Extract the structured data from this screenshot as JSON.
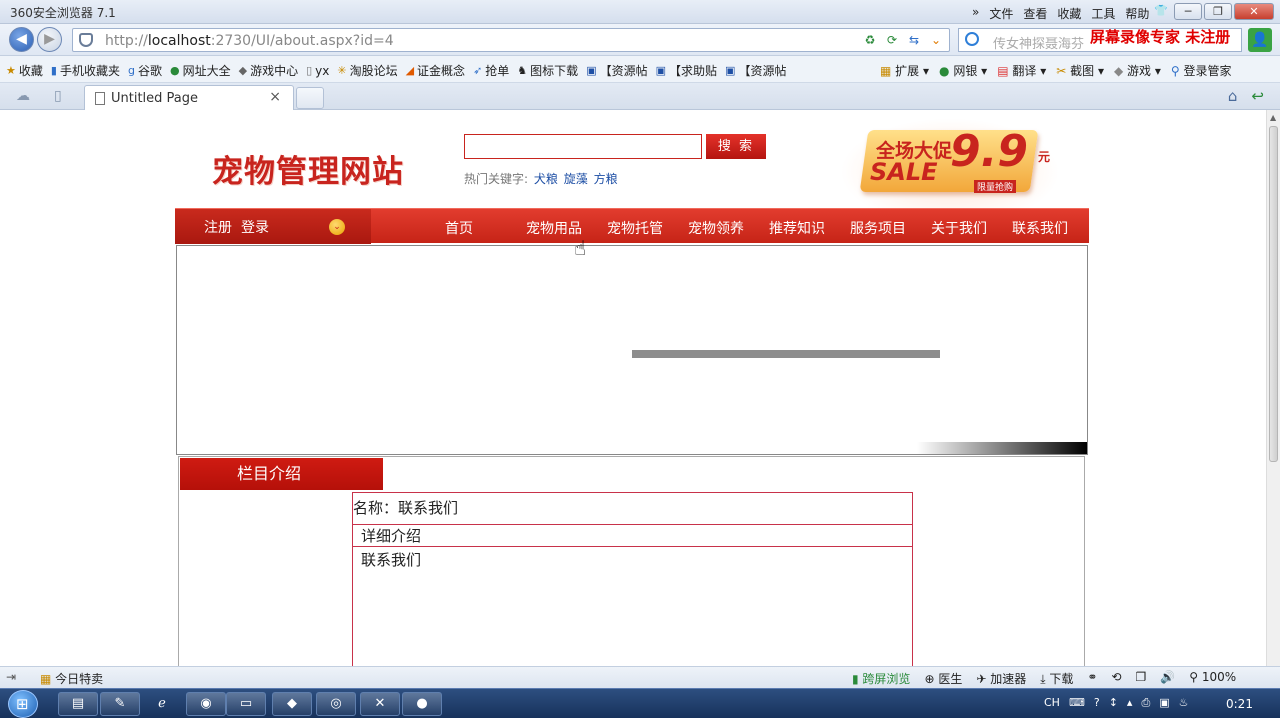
{
  "window": {
    "title": "360安全浏览器 7.1",
    "menus": [
      "»",
      "文件",
      "查看",
      "收藏",
      "工具",
      "帮助"
    ],
    "controls": {
      "shirt": "👕",
      "min": "─",
      "max": "❐",
      "close": "✕"
    }
  },
  "addressbar": {
    "back": "◀",
    "forward": "▶",
    "url_prefix": "http://",
    "url_host": "localhost",
    "url_rest": ":2730/UI/about.aspx?id=4",
    "icons": [
      "♻",
      "⟳",
      "⇆",
      "⌄"
    ],
    "search_placeholder": "传女神探聂海芬",
    "watermark": "屏幕录像专家  未注册",
    "user": "👤"
  },
  "favorites": {
    "items": [
      "收藏",
      "手机收藏夹",
      "谷歌",
      "网址大全",
      "游戏中心",
      "yx",
      "淘股论坛",
      "证金概念",
      "抢单",
      "图标下载",
      "【资源帖",
      "【求助贴",
      "【资源帖"
    ],
    "right_items": [
      "扩展",
      "网银",
      "翻译",
      "截图",
      "游戏",
      "登录管家"
    ]
  },
  "tabs": {
    "active_label": "Untitled Page",
    "close": "×",
    "cloud": "☁",
    "phone": "▯",
    "home": "⌂",
    "back": "↩"
  },
  "site": {
    "logo": "宠物管理网站",
    "search_button": "搜 索",
    "hot_label": "热门关键字:",
    "hot_keywords": [
      "犬粮",
      "旋藻",
      "方粮"
    ],
    "promo": {
      "line1": "全场大促",
      "line2": "SALE",
      "price": "9.9",
      "unit": "元",
      "tag": "限量抢购"
    },
    "nav": {
      "register": "注册",
      "login": "登录",
      "dropdown": "⌄",
      "links": [
        "首页",
        "宠物用品",
        "宠物托管",
        "宠物领养",
        "推荐知识",
        "服务项目",
        "关于我们",
        "联系我们"
      ]
    },
    "section": {
      "tab_title": "栏目介绍",
      "name_row": "名称：联系我们",
      "detail_head": "详细介绍",
      "content": "联系我们"
    }
  },
  "statusbar": {
    "left_icon": "⇥",
    "today": "今日特卖",
    "items": [
      "跨屏浏览",
      "医生",
      "加速器",
      "下载",
      "⚭",
      "⟲",
      "❐",
      "🔊",
      "100%"
    ]
  },
  "taskbar": {
    "tray": [
      "CH",
      "⌨",
      "?",
      "↕",
      "▴",
      "⎙",
      "▣",
      "♨"
    ],
    "clock": "0:21"
  }
}
